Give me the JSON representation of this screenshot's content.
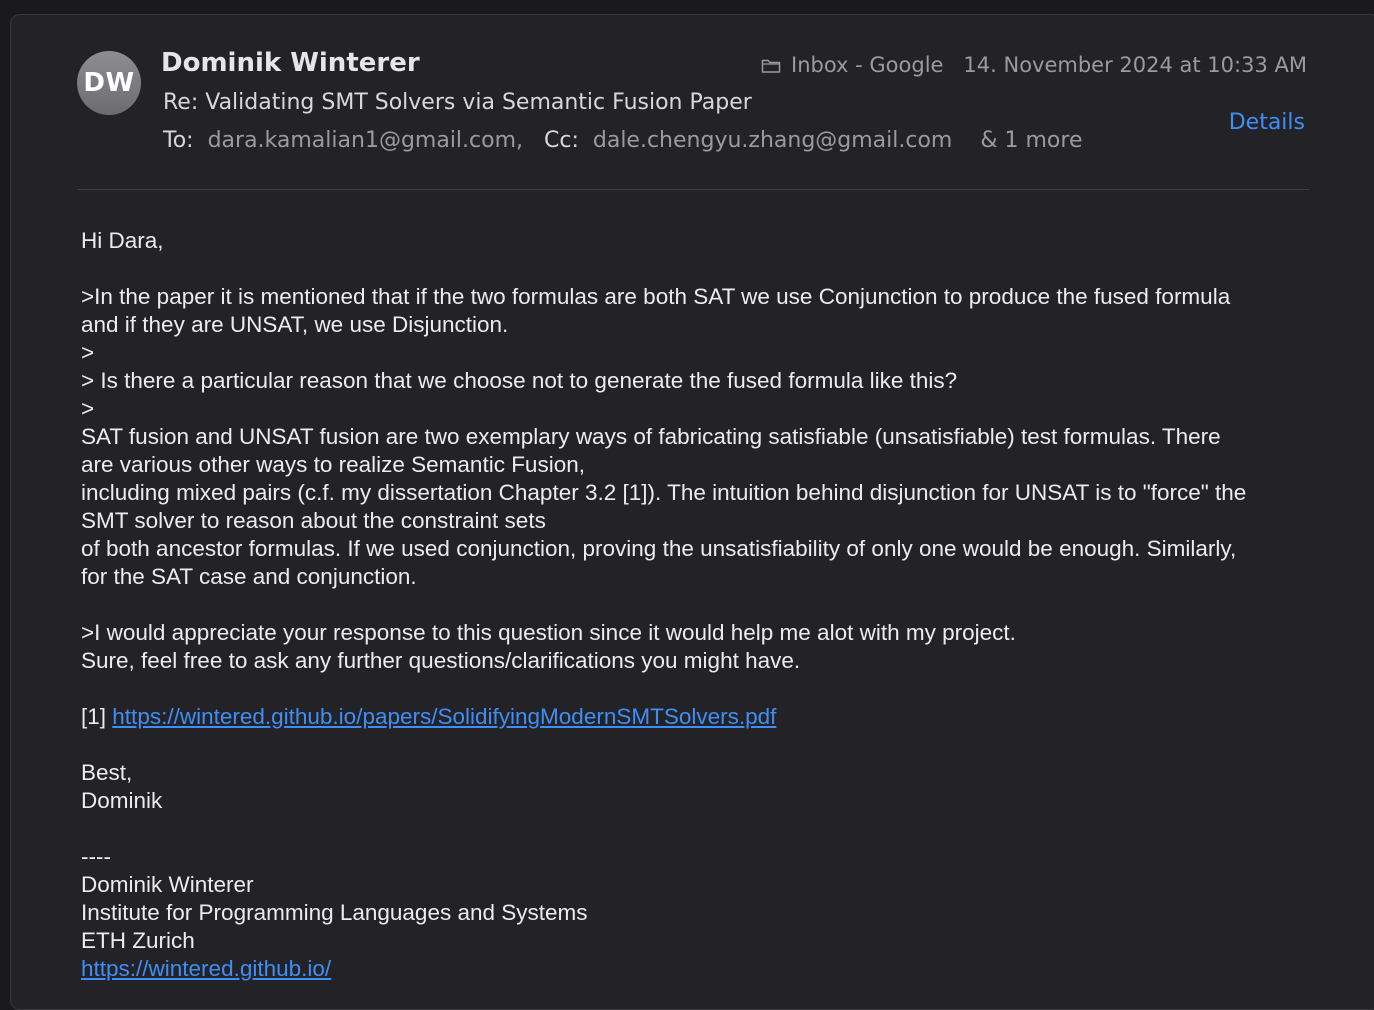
{
  "header": {
    "avatar_initials": "DW",
    "sender_name": "Dominik Winterer",
    "subject": "Re: Validating SMT Solvers via Semantic Fusion Paper",
    "to_label": "To:",
    "to_address": "dara.kamalian1@gmail.com,",
    "cc_label": "Cc:",
    "cc_address": "dale.chengyu.zhang@gmail.com",
    "more_recipients": "& 1 more",
    "mailbox": "Inbox - Google",
    "mailbox_icon": "folder-icon",
    "date": "14. November 2024 at 10:33 AM",
    "details_label": "Details",
    "link_color": "#3f8ef5"
  },
  "body": {
    "greeting": "Hi Dara,",
    "quote1_line1": ">In the paper it is mentioned that if the two formulas are both SAT we use Conjunction to produce the fused formula",
    "quote1_line2": "and if they are UNSAT, we use Disjunction.",
    "quote_marker1": ">",
    "quote2": "> Is there a particular reason that we choose not to generate the fused formula like this?",
    "quote_marker2": ">",
    "reply1_line1": "SAT fusion and UNSAT fusion are two exemplary ways of fabricating satisfiable (unsatisfiable) test formulas. There",
    "reply1_line2": "are various other ways to realize Semantic Fusion,",
    "reply1_line3": "including mixed pairs (c.f. my dissertation Chapter 3.2 [1]). The intuition behind disjunction for UNSAT is to \"force\" the",
    "reply1_line4": "SMT solver to reason about the constraint sets",
    "reply1_line5": "of both ancestor formulas. If we used conjunction, proving the unsatisfiability of only one would be enough. Similarly,",
    "reply1_line6": "for the SAT case and conjunction.",
    "quote3": ">I would appreciate your response to this question since it would help me alot with my project.",
    "reply2": "Sure, feel free to ask any further questions/clarifications you might have.",
    "ref_prefix": "[1]",
    "ref_link": "https://wintered.github.io/papers/SolidifyingModernSMTSolvers.pdf",
    "closing": "Best,",
    "sign_name": "Dominik",
    "sig_separator": "----",
    "sig_name": "Dominik Winterer",
    "sig_institute": "Institute for Programming Languages and Systems",
    "sig_university": "ETH Zurich",
    "sig_link": "https://wintered.github.io/"
  }
}
